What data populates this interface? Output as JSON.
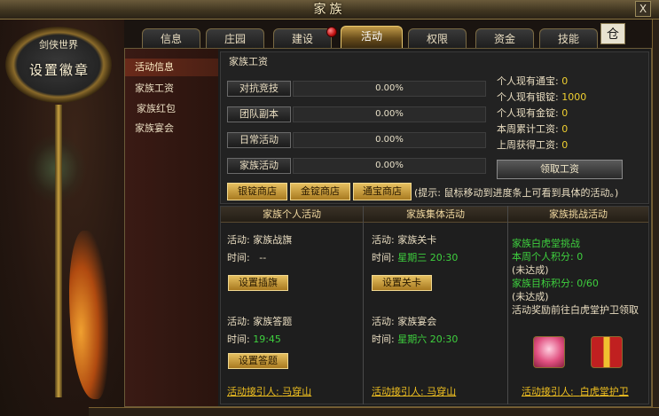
{
  "window": {
    "title": "家族",
    "close": "X"
  },
  "emblem": {
    "world": "剑侠世界",
    "button": "设置徽章"
  },
  "tabs": [
    {
      "label": "信息"
    },
    {
      "label": "庄园"
    },
    {
      "label": "建设"
    },
    {
      "label": "活动"
    },
    {
      "label": "权限"
    },
    {
      "label": "资金"
    },
    {
      "label": "技能"
    }
  ],
  "active_tab": "活动",
  "tab_extra": "仓",
  "sidebar": [
    {
      "label": "活动信息"
    },
    {
      "label": "家族工资"
    },
    {
      "label": "家族红包"
    },
    {
      "label": "家族宴会"
    }
  ],
  "wages": {
    "title": "家族工资",
    "rows": [
      {
        "label": "对抗竞技",
        "percent": "0.00%",
        "progress": 0
      },
      {
        "label": "团队副本",
        "percent": "0.00%",
        "progress": 0
      },
      {
        "label": "日常活动",
        "percent": "0.00%",
        "progress": 0
      },
      {
        "label": "家族活动",
        "percent": "0.00%",
        "progress": 0
      }
    ],
    "stats": [
      {
        "label": "个人现有通宝:",
        "value": "0"
      },
      {
        "label": "个人现有银锭:",
        "value": "1000"
      },
      {
        "label": "个人现有金锭:",
        "value": "0"
      },
      {
        "label": "本周累计工资:",
        "value": "0"
      },
      {
        "label": "上周获得工资:",
        "value": "0"
      }
    ],
    "claim_button": "领取工资",
    "shops": [
      "银锭商店",
      "金锭商店",
      "通宝商店"
    ],
    "hint": "(提示: 鼠标移动到进度条上可看到具体的活动。)"
  },
  "columns": {
    "personal": {
      "header": "家族个人活动",
      "act1_label": "活动:",
      "act1_name": "家族战旗",
      "time1_label": "时间:",
      "time1_value": "--",
      "btn1": "设置插旗",
      "act2_label": "活动:",
      "act2_name": "家族答题",
      "time2_label": "时间:",
      "time2_value": "19:45",
      "btn2": "设置答题",
      "npc_label": "活动接引人:",
      "npc": "马穿山"
    },
    "group": {
      "header": "家族集体活动",
      "act1_label": "活动:",
      "act1_name": "家族关卡",
      "time1_label": "时间:",
      "time1_value": "星期三 20:30",
      "btn1": "设置关卡",
      "act2_label": "活动:",
      "act2_name": "家族宴会",
      "time2_label": "时间:",
      "time2_value": "星期六 20:30",
      "npc_label": "活动接引人:",
      "npc": "马穿山"
    },
    "challenge": {
      "header": "家族挑战活动",
      "line1": "家族白虎堂挑战",
      "line2": "本周个人积分: 0",
      "line3": "(未达成)",
      "line4": "家族目标积分: 0/60",
      "line5": "(未达成)",
      "line6": "活动奖励前往白虎堂护卫领取",
      "npc_label": "活动接引人:",
      "npc": "白虎堂护卫"
    }
  },
  "colors": {
    "accent": "#c09a48",
    "green": "#3ed03e",
    "gold": "#f0c020"
  }
}
